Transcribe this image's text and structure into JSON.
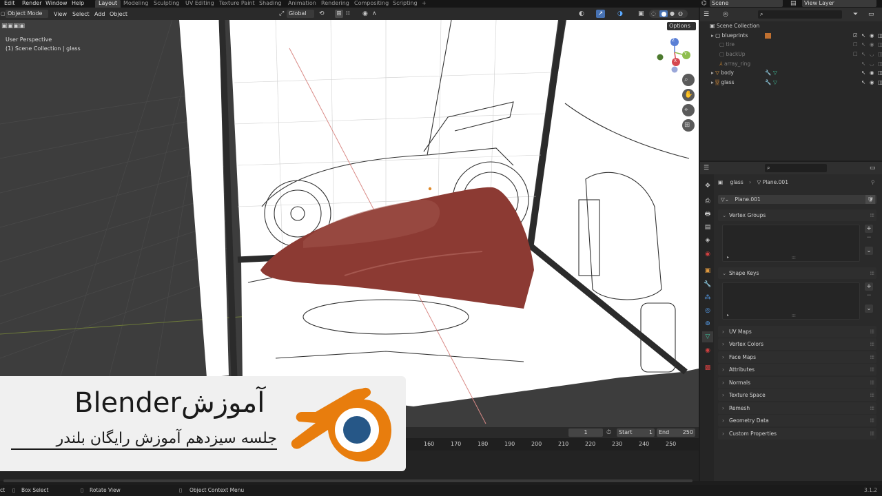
{
  "menus": [
    "Edit",
    "Render",
    "Window",
    "Help"
  ],
  "workspaces": [
    "Layout",
    "Modeling",
    "Sculpting",
    "UV Editing",
    "Texture Paint",
    "Shading",
    "Animation",
    "Rendering",
    "Compositing",
    "Scripting",
    "+"
  ],
  "active_workspace": "Layout",
  "scene": "Scene",
  "view_layer": "View Layer",
  "header": {
    "mode": "Object Mode",
    "items": [
      "View",
      "Select",
      "Add",
      "Object"
    ],
    "orientation": "Global",
    "options": "Options"
  },
  "viewport": {
    "perspective": "User Perspective",
    "collection": "(1) Scene Collection | glass",
    "axes": [
      "Z",
      "Y",
      "X"
    ],
    "bg": "#ffffff",
    "accent": "#8c3a33"
  },
  "outliner": {
    "root": "Scene Collection",
    "items": [
      {
        "label": "blueprints",
        "checked": true
      },
      {
        "label": "tire",
        "checked": false
      },
      {
        "label": "backUp",
        "checked": false
      },
      {
        "label": "array_ring",
        "checked": false
      },
      {
        "label": "body",
        "checked": false
      },
      {
        "label": "glass",
        "checked": false
      }
    ]
  },
  "properties": {
    "breadcrumb_obj": "glass",
    "breadcrumb_data": "Plane.001",
    "mesh_name": "Plane.001",
    "panels_open": [
      "Vertex Groups",
      "Shape Keys"
    ],
    "panels": [
      "UV Maps",
      "Vertex Colors",
      "Face Maps",
      "Attributes",
      "Normals",
      "Texture Space",
      "Remesh",
      "Geometry Data",
      "Custom Properties"
    ]
  },
  "timeline": {
    "current": "1",
    "start_label": "Start",
    "start": "1",
    "end_label": "End",
    "end": "250",
    "ticks": [
      "160",
      "170",
      "180",
      "190",
      "200",
      "210",
      "220",
      "230",
      "240",
      "250"
    ]
  },
  "status": {
    "left": "ct",
    "box_select": "Box Select",
    "rotate_view": "Rotate View",
    "context_menu": "Object Context Menu",
    "version": "3.1.2"
  },
  "banner": {
    "title_fa": "آموزش",
    "title_en": "Blender",
    "subtitle": "جلسه سیزدهم آموزش رایگان بلندر"
  },
  "colors": {
    "accent": "#4772b3",
    "orange": "#e87d0d",
    "blender_blue": "#265787"
  }
}
